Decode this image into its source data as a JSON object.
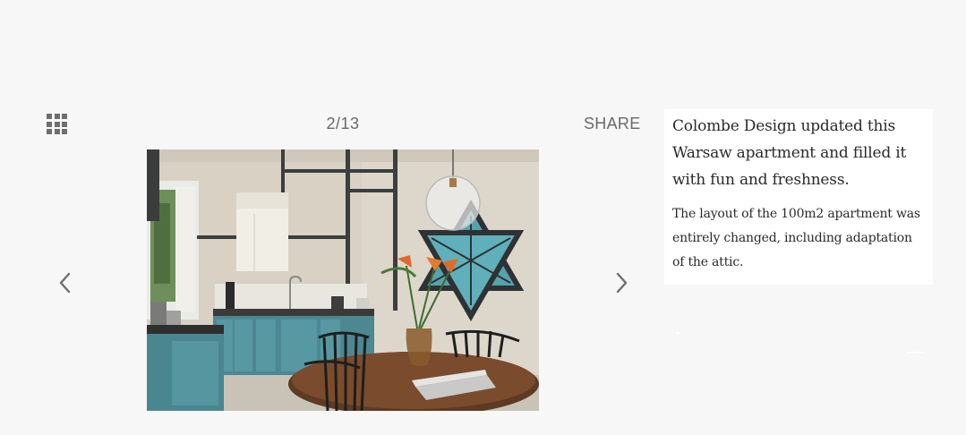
{
  "gallery": {
    "counter": "2/13",
    "share_label": "SHARE",
    "grid_icon": "grid-icon",
    "prev_icon": "chevron-left-icon",
    "next_icon": "chevron-right-icon"
  },
  "caption": {
    "title": "Colombe Design updated this Warsaw apartment and filled it with fun and freshness.",
    "body": "The layout of the 100m2 apartment was entirely changed, including adaptation of the attic."
  },
  "colors": {
    "background": "#f7f7f7",
    "icon_gray": "#6e6e6e",
    "text_dark": "#2a2a2a",
    "panel": "#ffffff"
  }
}
